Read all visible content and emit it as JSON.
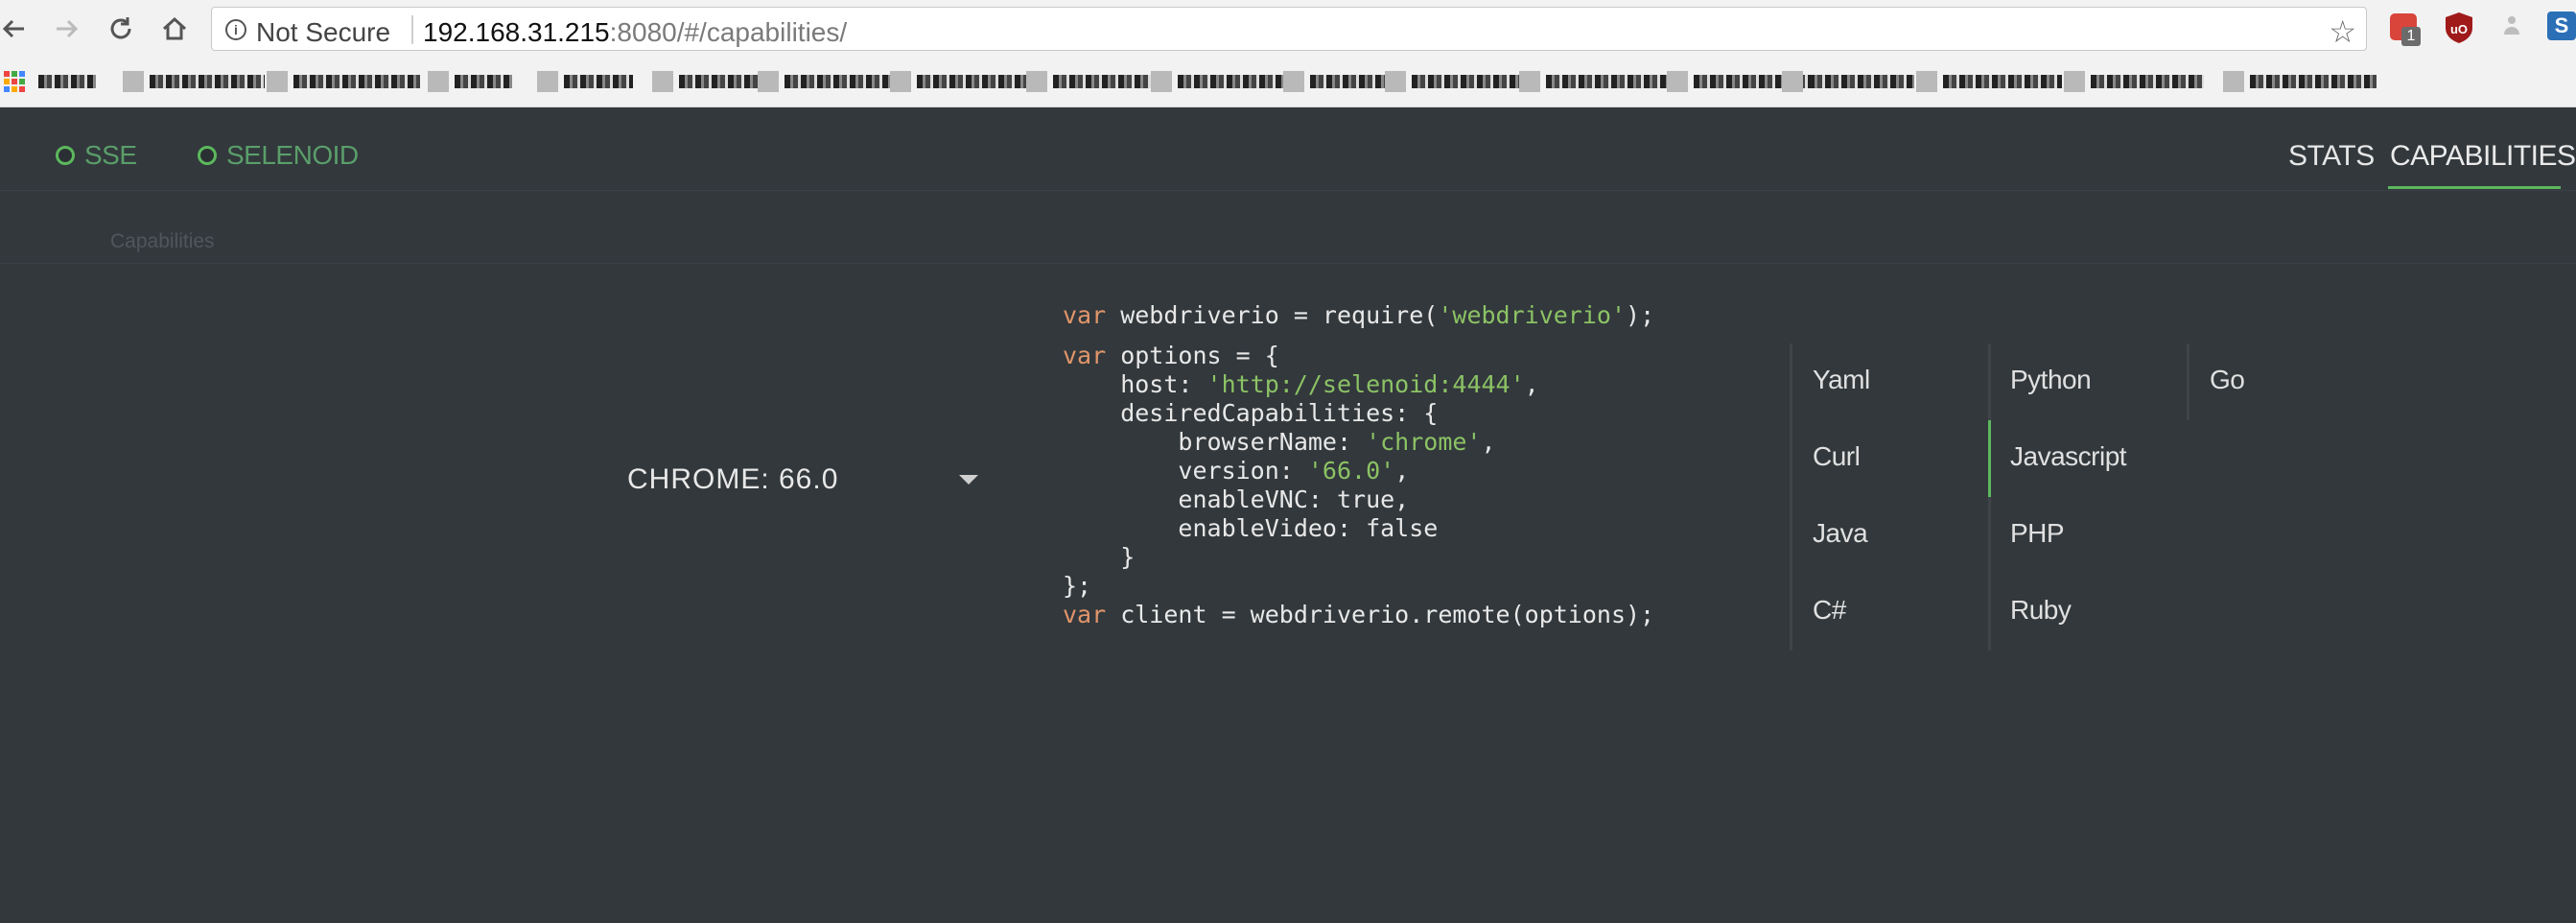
{
  "browser": {
    "security_label": "Not Secure",
    "url_host": "192.168.31.215",
    "url_path": ":8080/#/capabilities/",
    "extension_badge": "1"
  },
  "app": {
    "status": [
      {
        "label": "SSE",
        "color": "#5cb85c"
      },
      {
        "label": "SELENOID",
        "color": "#5cb85c"
      }
    ],
    "nav": {
      "stats": "STATS",
      "capabilities": "CAPABILITIES"
    },
    "breadcrumb": "Capabilities",
    "selected_browser": "CHROME: 66.0",
    "code_lines": [
      [
        {
          "t": "var",
          "c": "kw"
        },
        {
          "t": " webdriverio = require("
        },
        {
          "t": "'webdriverio'",
          "c": "str"
        },
        {
          "t": ");"
        }
      ],
      [],
      [
        {
          "t": "var",
          "c": "kw"
        },
        {
          "t": " options = {"
        }
      ],
      [
        {
          "t": "    host: "
        },
        {
          "t": "'http://selenoid:4444'",
          "c": "str"
        },
        {
          "t": ","
        }
      ],
      [
        {
          "t": "    desiredCapabilities: {"
        }
      ],
      [
        {
          "t": "        browserName: "
        },
        {
          "t": "'chrome'",
          "c": "str"
        },
        {
          "t": ","
        }
      ],
      [
        {
          "t": "        version: "
        },
        {
          "t": "'66.0'",
          "c": "str"
        },
        {
          "t": ","
        }
      ],
      [
        {
          "t": "        enableVNC: true,"
        }
      ],
      [
        {
          "t": "        enableVideo: false"
        }
      ],
      [
        {
          "t": "    }"
        }
      ],
      [
        {
          "t": "};"
        }
      ],
      [
        {
          "t": "var",
          "c": "kw"
        },
        {
          "t": " client = webdriverio.remote(options);"
        }
      ]
    ],
    "languages": {
      "yaml": "Yaml",
      "curl": "Curl",
      "java": "Java",
      "csharp": "C#",
      "python": "Python",
      "javascript": "Javascript",
      "php": "PHP",
      "ruby": "Ruby",
      "go": "Go"
    },
    "active_language": "Javascript",
    "accent_color": "#5cb85c"
  }
}
